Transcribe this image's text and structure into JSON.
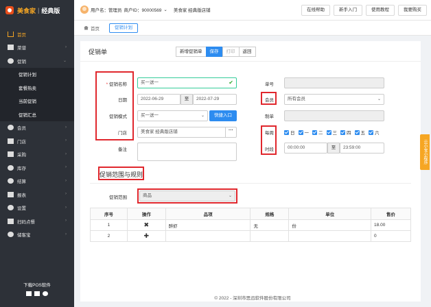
{
  "app": {
    "brand": "美食家",
    "edition": "经典版"
  },
  "header": {
    "user_label": "用户名：管理员",
    "merchant_label": "商户ID：90000569",
    "store": "美食家 经典版店铺",
    "buttons": [
      "在线帮助",
      "新手入门",
      "使用教程",
      "我要购买"
    ]
  },
  "sidebar": {
    "items": [
      {
        "label": "首页",
        "icon": "home-icon"
      },
      {
        "label": "菜谱",
        "icon": "menu-icon"
      },
      {
        "label": "促销",
        "icon": "promo-icon"
      },
      {
        "label": "促销计划"
      },
      {
        "label": "套餐热卖"
      },
      {
        "label": "当前促销"
      },
      {
        "label": "促销汇总"
      },
      {
        "label": "会员",
        "icon": "member-icon"
      },
      {
        "label": "门店",
        "icon": "store-icon"
      },
      {
        "label": "采购",
        "icon": "purchase-icon"
      },
      {
        "label": "库存",
        "icon": "inventory-icon"
      },
      {
        "label": "结算",
        "icon": "settle-icon"
      },
      {
        "label": "报表",
        "icon": "report-icon"
      },
      {
        "label": "设置",
        "icon": "settings-icon"
      },
      {
        "label": "扫码点餐",
        "icon": "qr-order-icon"
      },
      {
        "label": "储客宝",
        "icon": "customer-icon"
      }
    ],
    "pos_download": "下载POS软件"
  },
  "breadcrumb": {
    "home": "首页",
    "current": "促销计划"
  },
  "panel": {
    "title": "促销单",
    "buttons": {
      "new": "新增促销单",
      "save": "保存",
      "print": "打印",
      "back": "返回"
    }
  },
  "form": {
    "name_label": "促销名称",
    "name_value": "买一送一",
    "date_label": "日期",
    "date_from": "2022-06-29",
    "date_to_sep": "至",
    "date_to": "2022-07-29",
    "mode_label": "促销模式",
    "mode_value": "买一送一",
    "quick_entry": "快捷入口",
    "store_label": "门店",
    "store_value": "美食家 经典版店铺",
    "store_more": "···",
    "note_label": "备注",
    "no_label": "单号",
    "member_label": "会员",
    "member_value": "所有会员",
    "maker_label": "制单",
    "weekly_label": "每周",
    "weekdays": [
      "日",
      "一",
      "二",
      "三",
      "四",
      "五",
      "六"
    ],
    "time_label": "时段",
    "time_from": "00:00:00",
    "time_sep": "至",
    "time_to": "23:59:00"
  },
  "rules": {
    "section_title": "促销范围与规则",
    "scope_label": "促销范围",
    "scope_value": "商品"
  },
  "table": {
    "headers": [
      "序号",
      "操作",
      "品项",
      "规格",
      "单位",
      "售价"
    ],
    "rows": [
      {
        "no": "1",
        "op": "✖",
        "item": "醉虾",
        "spec": "无",
        "unit": "份",
        "price": "18.00"
      },
      {
        "no": "2",
        "op": "✚",
        "item": "",
        "spec": "",
        "unit": "",
        "price": "0"
      }
    ]
  },
  "footer": "© 2022 - 深圳市思迅软件股份有限公司",
  "side_tab": "云小宝小程序"
}
